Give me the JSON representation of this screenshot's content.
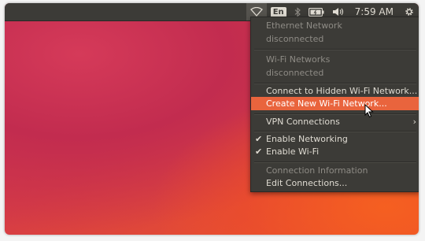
{
  "topbar": {
    "wifi_icon": "wifi-icon",
    "keyboard_layout": "En",
    "bluetooth_icon": "bluetooth-icon",
    "battery_icon": "battery-icon",
    "volume_icon": "volume-icon",
    "clock": "7:59 AM",
    "settings_icon": "gear-icon"
  },
  "menu": {
    "ethernet_title": "Ethernet Network",
    "ethernet_status": "disconnected",
    "wifi_title": "Wi-Fi Networks",
    "wifi_status": "disconnected",
    "connect_hidden": "Connect to Hidden Wi-Fi Network...",
    "create_new": "Create New Wi-Fi Network...",
    "vpn": "VPN Connections",
    "enable_networking": "Enable Networking",
    "enable_wifi": "Enable Wi-Fi",
    "connection_info": "Connection Information",
    "edit_connections": "Edit Connections...",
    "checkmark": "✔",
    "submenu_arrow": "›"
  },
  "colors": {
    "panel": "#3c3b37",
    "highlight": "#e9643d",
    "text": "#dfdbd2",
    "dim_text": "#8e8b85"
  }
}
